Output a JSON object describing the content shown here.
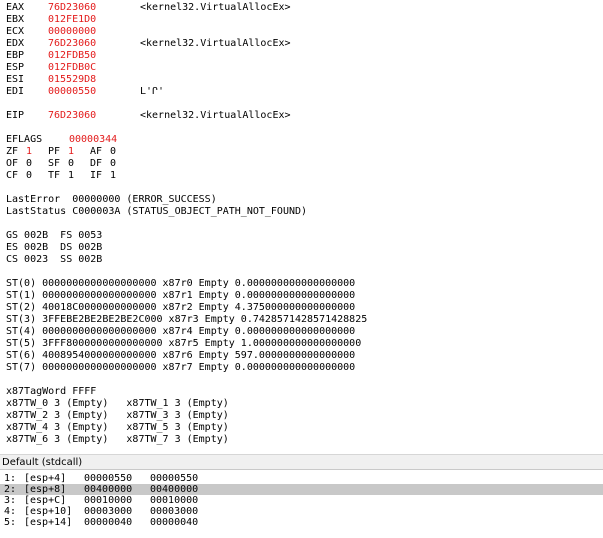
{
  "registers": [
    {
      "name": "EAX",
      "value": "76D23060",
      "comment": "<kernel32.VirtualAllocEx>"
    },
    {
      "name": "EBX",
      "value": "012FE1D0",
      "comment": ""
    },
    {
      "name": "ECX",
      "value": "00000000",
      "comment": ""
    },
    {
      "name": "EDX",
      "value": "76D23060",
      "comment": "<kernel32.VirtualAllocEx>"
    },
    {
      "name": "EBP",
      "value": "012FDB50",
      "comment": ""
    },
    {
      "name": "ESP",
      "value": "012FDB0C",
      "comment": ""
    },
    {
      "name": "ESI",
      "value": "015529D8",
      "comment": ""
    },
    {
      "name": "EDI",
      "value": "00000550",
      "comment": "L'Ր'"
    }
  ],
  "eip": {
    "name": "EIP",
    "value": "76D23060",
    "comment": "<kernel32.VirtualAllocEx>"
  },
  "eflags": {
    "name": "EFLAGS",
    "value": "00000344"
  },
  "flags_rows": [
    [
      {
        "n": "ZF",
        "v": "1",
        "red": true
      },
      {
        "n": "PF",
        "v": "1",
        "red": true
      },
      {
        "n": "AF",
        "v": "0",
        "red": false
      }
    ],
    [
      {
        "n": "OF",
        "v": "0",
        "red": false
      },
      {
        "n": "SF",
        "v": "0",
        "red": false
      },
      {
        "n": "DF",
        "v": "0",
        "red": false
      }
    ],
    [
      {
        "n": "CF",
        "v": "0",
        "red": false
      },
      {
        "n": "TF",
        "v": "1",
        "red": false
      },
      {
        "n": "IF",
        "v": "1",
        "red": false
      }
    ]
  ],
  "last_error": "LastError  00000000 (ERROR_SUCCESS)",
  "last_status": "LastStatus C000003A (STATUS_OBJECT_PATH_NOT_FOUND)",
  "segments": [
    "GS 002B  FS 0053",
    "ES 002B  DS 002B",
    "CS 0023  SS 002B"
  ],
  "fpu": [
    "ST(0) 0000000000000000000 x87r0 Empty 0.000000000000000000",
    "ST(1) 0000000000000000000 x87r1 Empty 0.000000000000000000",
    "ST(2) 40018C0000000000000 x87r2 Empty 4.375000000000000000",
    "ST(3) 3FFEBE2BE2BE2BE2C000 x87r3 Empty 0.7428571428571428825",
    "ST(4) 0000000000000000000 x87r4 Empty 0.000000000000000000",
    "ST(5) 3FFF8000000000000000 x87r5 Empty 1.000000000000000000",
    "ST(6) 4008954000000000000 x87r6 Empty 597.0000000000000000",
    "ST(7) 0000000000000000000 x87r7 Empty 0.000000000000000000"
  ],
  "tagword": "x87TagWord FFFF",
  "tw_rows": [
    "x87TW_0 3 (Empty)   x87TW_1 3 (Empty)",
    "x87TW_2 3 (Empty)   x87TW_3 3 (Empty)",
    "x87TW_4 3 (Empty)   x87TW_5 3 (Empty)",
    "x87TW_6 3 (Empty)   x87TW_7 3 (Empty)"
  ],
  "stack_header": "Default (stdcall)",
  "stack_rows": [
    {
      "idx": "1:",
      "addr": "[esp+4]",
      "v1": "00000550",
      "v2": "00000550",
      "selected": false
    },
    {
      "idx": "2:",
      "addr": "[esp+8]",
      "v1": "00400000",
      "v2": "00400000",
      "selected": true
    },
    {
      "idx": "3:",
      "addr": "[esp+C]",
      "v1": "00010000",
      "v2": "00010000",
      "selected": false
    },
    {
      "idx": "4:",
      "addr": "[esp+10]",
      "v1": "00003000",
      "v2": "00003000",
      "selected": false
    },
    {
      "idx": "5:",
      "addr": "[esp+14]",
      "v1": "00000040",
      "v2": "00000040",
      "selected": false
    }
  ]
}
